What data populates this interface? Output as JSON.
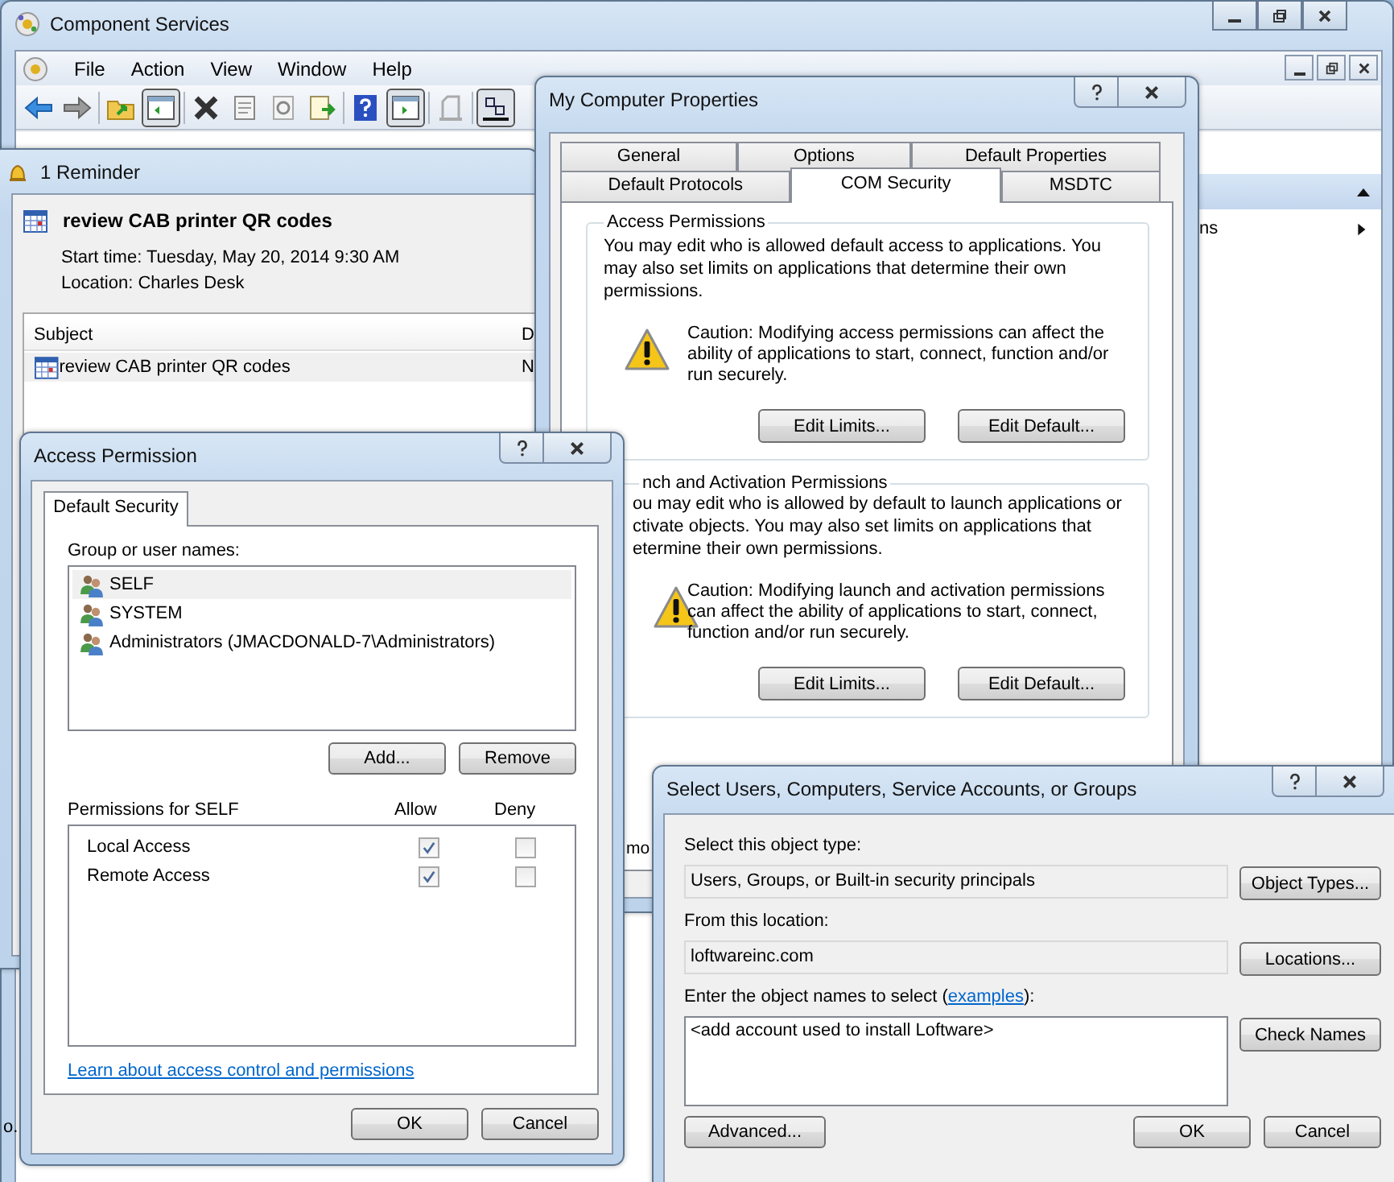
{
  "main_window": {
    "title": "Component Services",
    "menu": [
      "File",
      "Action",
      "View",
      "Window",
      "Help"
    ],
    "actions_item": "ns",
    "fragment": "o."
  },
  "reminder": {
    "title": "1 Reminder",
    "subject": "review CAB printer QR codes",
    "start_time": "Start time: Tuesday, May 20, 2014 9:30 AM",
    "location": "Location: Charles Desk",
    "columns": [
      "Subject",
      "D"
    ],
    "rows": [
      {
        "cells": [
          "review CAB printer QR codes",
          "N"
        ],
        "selected": true
      }
    ]
  },
  "properties": {
    "title": "My Computer Properties",
    "tab_rows": [
      [
        {
          "label": "General",
          "selected": false
        },
        {
          "label": "Options",
          "selected": false
        },
        {
          "label": "Default Properties",
          "selected": false
        }
      ],
      [
        {
          "label": "Default Protocols",
          "selected": false
        },
        {
          "label": "COM Security",
          "selected": true
        },
        {
          "label": "MSDTC",
          "selected": false
        }
      ]
    ],
    "groups": [
      {
        "title": "Access Permissions",
        "text": "You may edit who is allowed default access to applications. You may also set limits on applications that determine their own permissions.",
        "caution": "Caution: Modifying access permissions can affect the ability of applications to start, connect, function and/or run securely.",
        "buttons": [
          "Edit Limits...",
          "Edit Default..."
        ]
      },
      {
        "title": "nch and Activation Permissions",
        "text_lines": [
          "ou may edit who is allowed by default to launch applications or",
          "ctivate objects. You may also set limits on applications that",
          "etermine their own permissions."
        ],
        "caution": "Caution: Modifying launch and activation permissions can affect the ability of applications to start, connect, function and/or run securely.",
        "buttons": [
          "Edit Limits...",
          "Edit Default..."
        ]
      }
    ],
    "fragment": "mo"
  },
  "access_permission": {
    "title": "Access Permission",
    "tab": "Default Security",
    "users_label": "Group or user names:",
    "users": [
      {
        "name": "SELF",
        "selected": true
      },
      {
        "name": "SYSTEM",
        "selected": false
      },
      {
        "name": "Administrators (JMACDONALD-7\\Administrators)",
        "selected": false
      }
    ],
    "user_buttons": [
      "Add...",
      "Remove"
    ],
    "permissions_label": "Permissions for SELF",
    "allow_label": "Allow",
    "deny_label": "Deny",
    "permissions": [
      {
        "name": "Local Access",
        "allow": true,
        "deny": false
      },
      {
        "name": "Remote Access",
        "allow": true,
        "deny": false
      }
    ],
    "link": "Learn about access control and permissions",
    "buttons": [
      "OK",
      "Cancel"
    ]
  },
  "select_users": {
    "title": "Select Users, Computers, Service Accounts, or Groups",
    "object_type_label": "Select this object type:",
    "object_type": "Users, Groups, or Built-in security principals",
    "object_types_button": "Object Types...",
    "location_label": "From this location:",
    "location": "loftwareinc.com",
    "locations_button": "Locations...",
    "names_label": "Enter the object names to select (",
    "names_link": "examples",
    "names_label_end": "):",
    "names_value": "<add account used to install Loftware>",
    "check_names_button": "Check Names",
    "advanced_button": "Advanced...",
    "buttons": [
      "OK",
      "Cancel"
    ]
  }
}
